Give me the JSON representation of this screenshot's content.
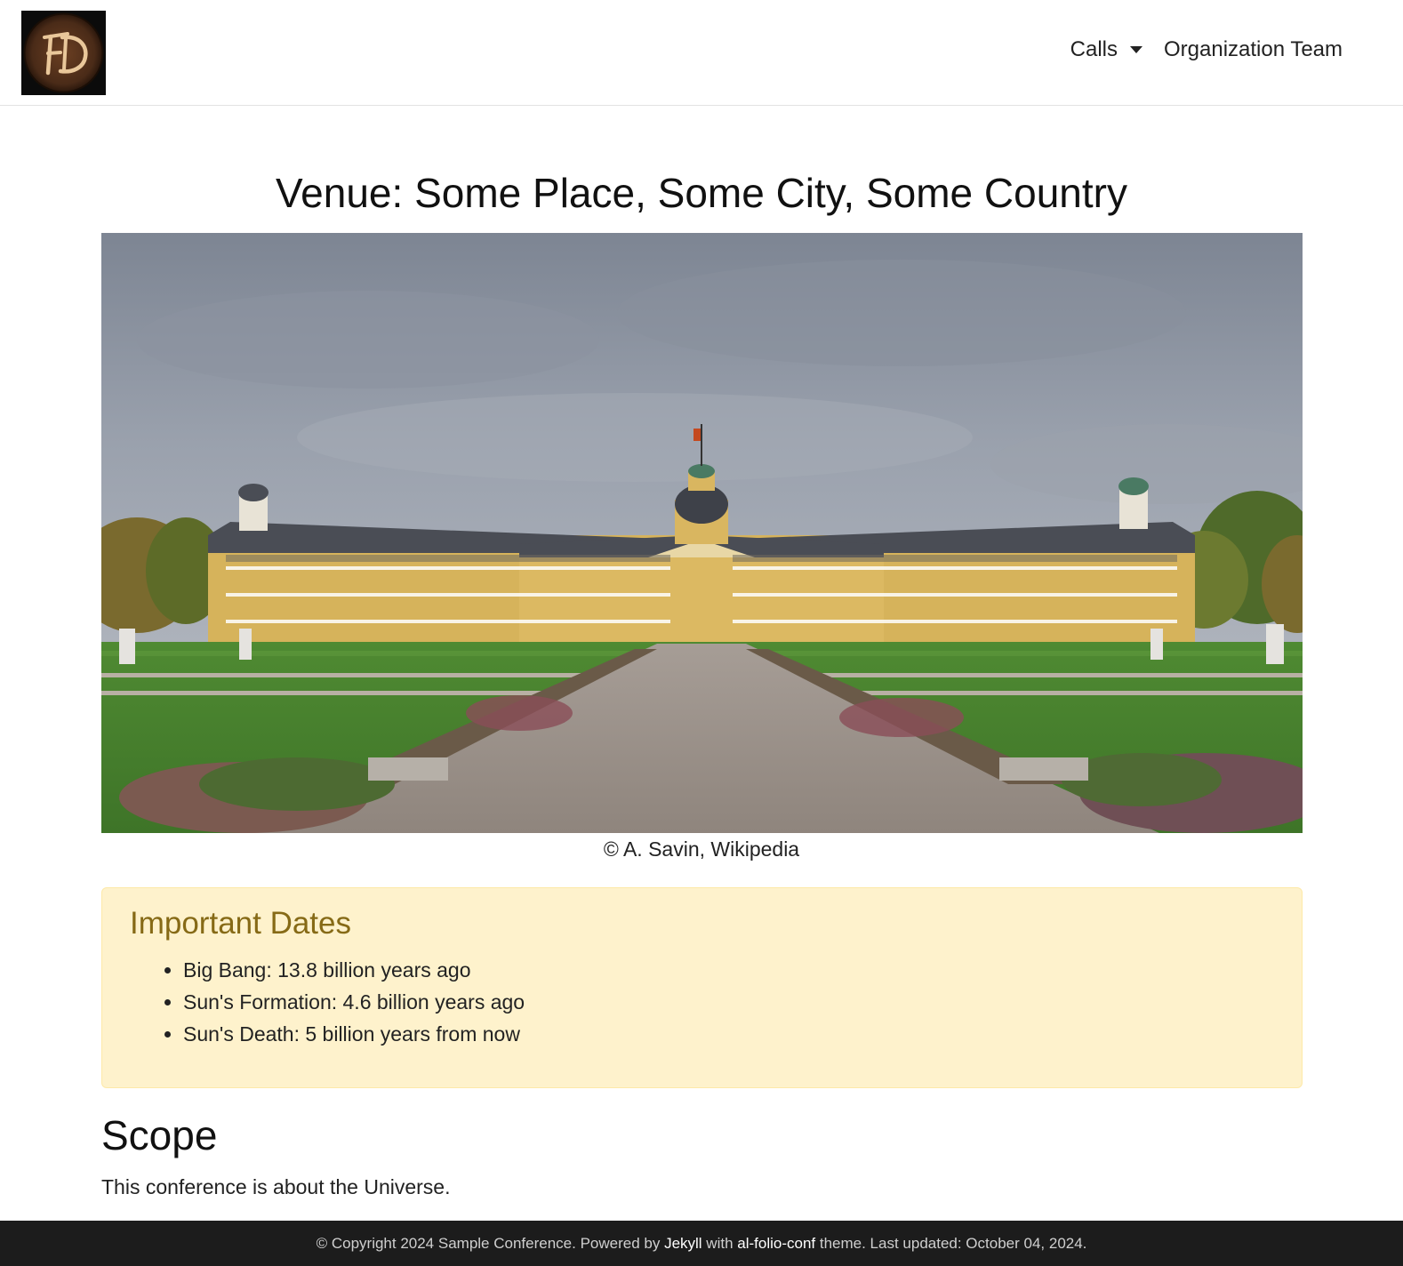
{
  "nav": {
    "logo_text": "FD",
    "logo_icon": "fd-monogram-logo",
    "items": [
      {
        "label": "Calls",
        "has_dropdown": true
      },
      {
        "label": "Organization Team",
        "has_dropdown": false
      }
    ]
  },
  "main": {
    "venue_title": "Venue: Some Place, Some City, Some Country",
    "hero_image": "baroque-palace-photo",
    "caption": "© A. Savin, Wikipedia",
    "important_dates": {
      "title": "Important Dates",
      "items": [
        "Big Bang: 13.8 billion years ago",
        "Sun's Formation: 4.6 billion years ago",
        "Sun's Death: 5 billion years from now"
      ]
    },
    "scope": {
      "title": "Scope",
      "text": "This conference is about the Universe."
    }
  },
  "footer": {
    "prefix": "© Copyright 2024 Sample Conference. Powered by ",
    "link1": "Jekyll",
    "mid": " with ",
    "link2": "al-folio-conf",
    "suffix": " theme. Last updated: October 04, 2024."
  },
  "colors": {
    "alert_bg": "#fef2cc",
    "alert_title": "#866a16",
    "footer_bg": "#1c1c1c",
    "logo_bg": "#0b0b0b",
    "logo_disc": "#4a2b18",
    "logo_letters": "#e9c79a"
  }
}
